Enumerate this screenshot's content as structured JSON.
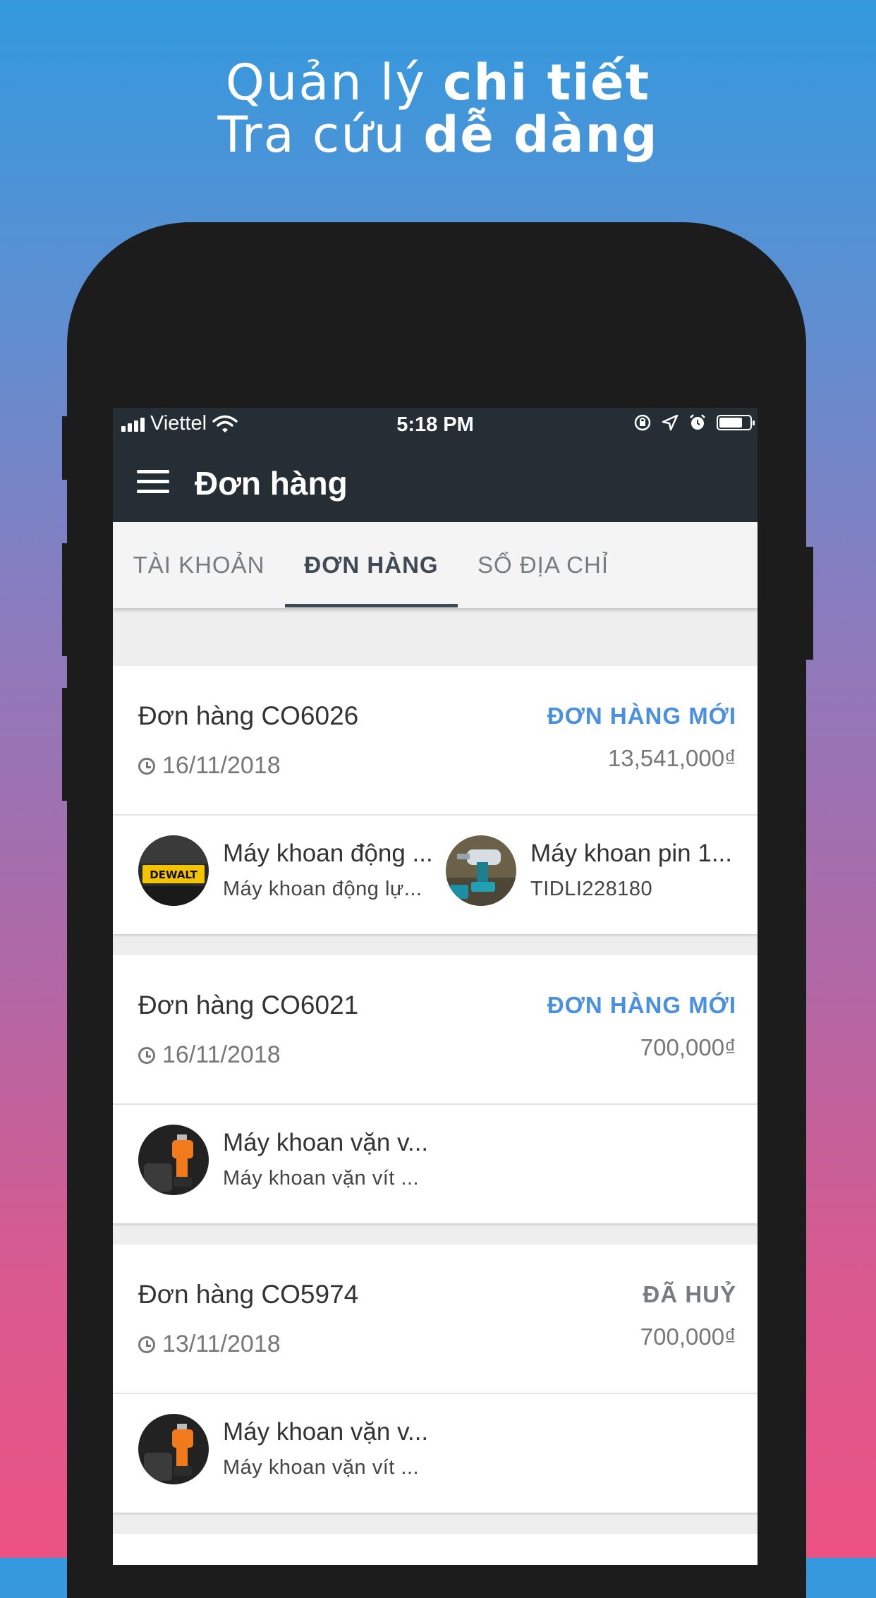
{
  "headline": {
    "line1_plain": "Quản lý ",
    "line1_bold": "chi tiết",
    "line2_plain": "Tra cứu ",
    "line2_bold": "dễ dàng"
  },
  "statusbar": {
    "carrier": "Viettel",
    "time": "5:18 PM"
  },
  "appbar": {
    "title": "Đơn hàng",
    "menu_icon": "hamburger-menu-icon"
  },
  "tabs": [
    {
      "label": "TÀI KHOẢN",
      "active": false
    },
    {
      "label": "ĐƠN HÀNG",
      "active": true
    },
    {
      "label": "SỔ ĐỊA CHỈ",
      "active": false
    }
  ],
  "colors": {
    "accent_blue": "#4a90e2",
    "status_grey": "#777c80",
    "appbar": "#252e35"
  },
  "orders": [
    {
      "name": "Đơn hàng CO6026",
      "date": "16/11/2018",
      "status": "ĐƠN HÀNG MỚI",
      "total": "13,541,000₫",
      "items": [
        {
          "name": "Máy khoan động ...",
          "sub": "Máy khoan động lự...",
          "thumb": "dewalt-drill-case"
        },
        {
          "name": "Máy khoan pin 1...",
          "sub": "TIDLI228180",
          "thumb": "cordless-drill"
        }
      ]
    },
    {
      "name": "Đơn hàng CO6021",
      "date": "16/11/2018",
      "status": "ĐƠN HÀNG MỚI",
      "total": "700,000₫",
      "items": [
        {
          "name": "Máy khoan vặn v...",
          "sub": "Máy khoan vặn vít ...",
          "thumb": "orange-screwdriver"
        }
      ]
    },
    {
      "name": "Đơn hàng CO5974",
      "date": "13/11/2018",
      "status": "ĐÃ HUỶ",
      "total": "700,000₫",
      "items": [
        {
          "name": "Máy khoan vặn v...",
          "sub": "Máy khoan vặn vít ...",
          "thumb": "orange-screwdriver"
        }
      ]
    }
  ]
}
